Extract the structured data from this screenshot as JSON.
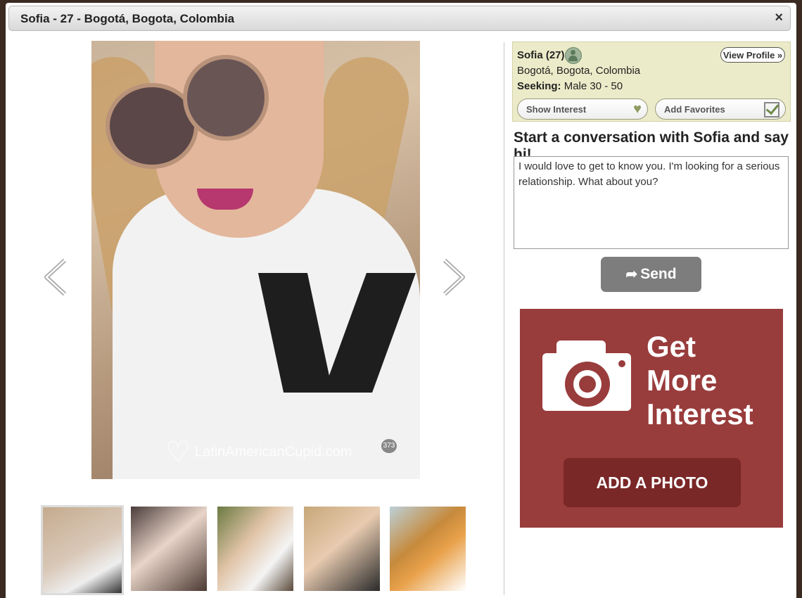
{
  "window": {
    "title": "Sofia - 27 - Bogotá, Bogota, Colombia",
    "close_icon": "×"
  },
  "photo": {
    "watermark": "LatinAmericanCupid.com",
    "photo_number": "373"
  },
  "profile": {
    "name_age": "Sofia (27)",
    "view_profile_label": "View Profile »",
    "location": "Bogotá, Bogota, Colombia",
    "seeking_label": "Seeking:",
    "seeking_value": "Male 30 - 50",
    "show_interest_label": "Show Interest",
    "add_favorites_label": "Add Favorites"
  },
  "conversation": {
    "heading": "Start a conversation with Sofia and say hi!",
    "message": "I would love to get to know you. I'm looking for a serious relationship. What about you?",
    "send_label": "Send"
  },
  "promo": {
    "line1": "Get",
    "line2": "More",
    "line3": "Interest",
    "button_label": "ADD A PHOTO"
  },
  "colors": {
    "promo_bg": "#993c3c",
    "promo_button": "#7a2727",
    "info_bg": "#ecebc9",
    "send_bg": "#7d7d7d"
  }
}
